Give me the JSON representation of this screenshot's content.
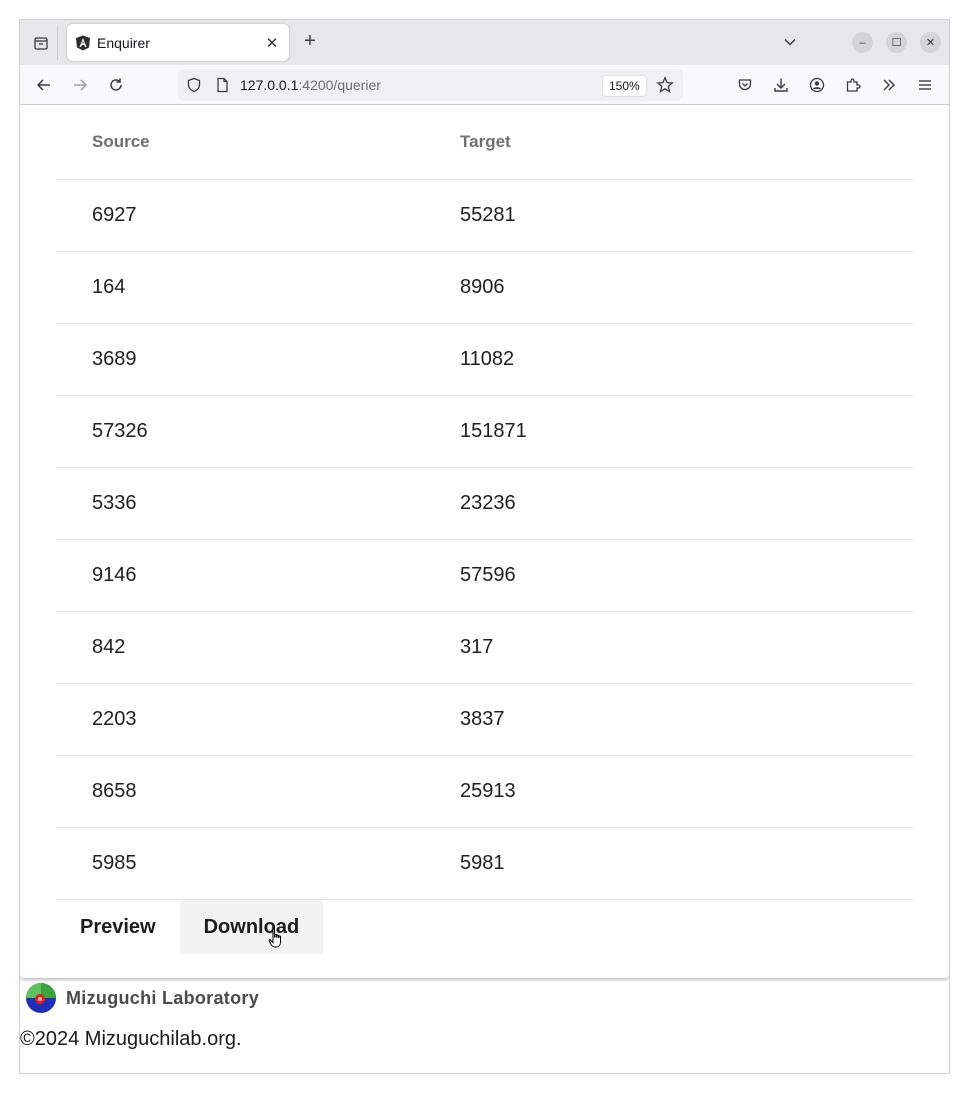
{
  "browser": {
    "tab_title": "Enquirer",
    "url_host": "127.0.0.1",
    "url_rest": ":4200/querier",
    "zoom": "150%"
  },
  "table": {
    "headers": [
      "Source",
      "Target"
    ],
    "rows": [
      [
        "6927",
        "55281"
      ],
      [
        "164",
        "8906"
      ],
      [
        "3689",
        "11082"
      ],
      [
        "57326",
        "151871"
      ],
      [
        "5336",
        "23236"
      ],
      [
        "9146",
        "57596"
      ],
      [
        "842",
        "317"
      ],
      [
        "2203",
        "3837"
      ],
      [
        "8658",
        "25913"
      ],
      [
        "5985",
        "5981"
      ]
    ]
  },
  "actions": {
    "preview_label": "Preview",
    "download_label": "Download"
  },
  "footer": {
    "lab_name": "Mizuguchi Laboratory",
    "copyright": "©2024 Mizuguchilab.org."
  }
}
